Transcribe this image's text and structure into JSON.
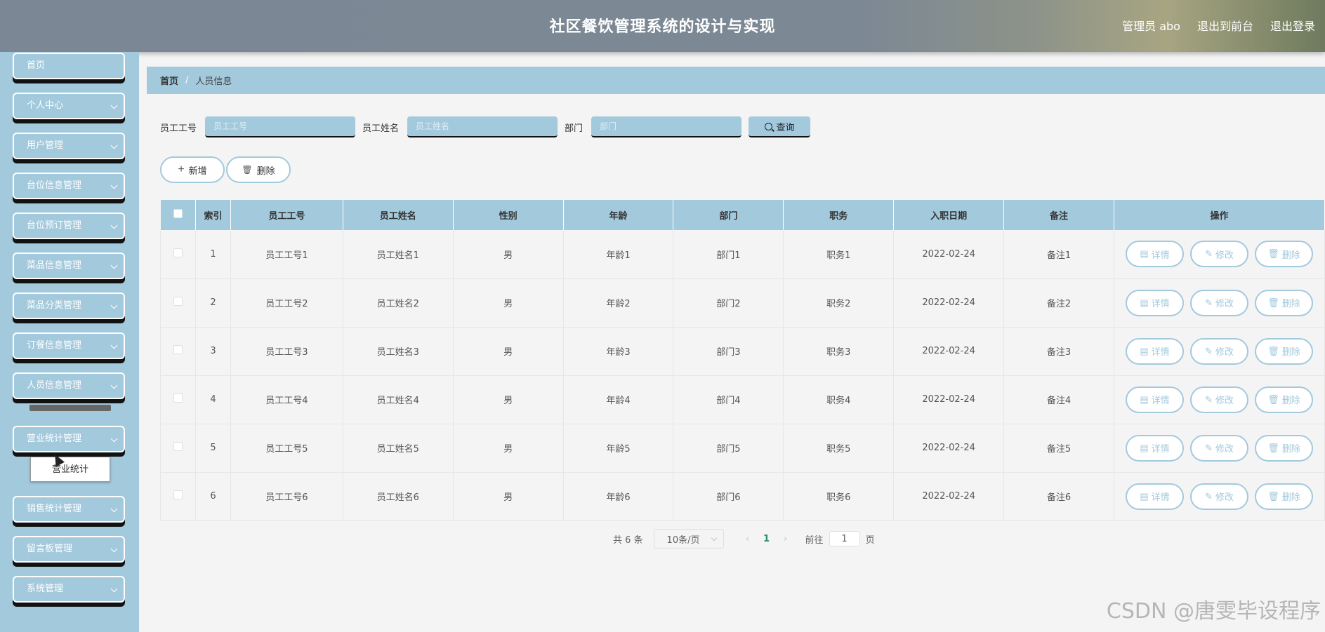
{
  "header": {
    "title": "社区餐饮管理系统的设计与实现",
    "user": "管理员 abo",
    "frontend_link": "退出到前台",
    "logout": "退出登录"
  },
  "sidebar": {
    "items": [
      {
        "label": "首页",
        "has_chevron": false
      },
      {
        "label": "个人中心",
        "has_chevron": true
      },
      {
        "label": "用户管理",
        "has_chevron": true
      },
      {
        "label": "台位信息管理",
        "has_chevron": true
      },
      {
        "label": "台位预订管理",
        "has_chevron": true
      },
      {
        "label": "菜品信息管理",
        "has_chevron": true
      },
      {
        "label": "菜品分类管理",
        "has_chevron": true
      },
      {
        "label": "订餐信息管理",
        "has_chevron": true
      },
      {
        "label": "人员信息管理",
        "has_chevron": true
      },
      {
        "label": "营业统计管理",
        "has_chevron": true
      },
      {
        "label": "销售统计管理",
        "has_chevron": true
      },
      {
        "label": "留言板管理",
        "has_chevron": true
      },
      {
        "label": "系统管理",
        "has_chevron": true
      }
    ],
    "popup_item": "营业统计"
  },
  "breadcrumb": {
    "home": "首页",
    "separator": "/",
    "current": "人员信息"
  },
  "search": {
    "emp_no_label": "员工工号",
    "emp_no_placeholder": "员工工号",
    "emp_name_label": "员工姓名",
    "emp_name_placeholder": "员工姓名",
    "dept_label": "部门",
    "dept_placeholder": "部门",
    "query_label": "查询"
  },
  "actions": {
    "add_label": "新增",
    "delete_label": "删除"
  },
  "table": {
    "headers": [
      "索引",
      "员工工号",
      "员工姓名",
      "性别",
      "年龄",
      "部门",
      "职务",
      "入职日期",
      "备注",
      "操作"
    ],
    "op_labels": {
      "detail": "详情",
      "edit": "修改",
      "delete": "删除"
    },
    "rows": [
      [
        "1",
        "员工工号1",
        "员工姓名1",
        "男",
        "年龄1",
        "部门1",
        "职务1",
        "2022-02-24",
        "备注1"
      ],
      [
        "2",
        "员工工号2",
        "员工姓名2",
        "男",
        "年龄2",
        "部门2",
        "职务2",
        "2022-02-24",
        "备注2"
      ],
      [
        "3",
        "员工工号3",
        "员工姓名3",
        "男",
        "年龄3",
        "部门3",
        "职务3",
        "2022-02-24",
        "备注3"
      ],
      [
        "4",
        "员工工号4",
        "员工姓名4",
        "男",
        "年龄4",
        "部门4",
        "职务4",
        "2022-02-24",
        "备注4"
      ],
      [
        "5",
        "员工工号5",
        "员工姓名5",
        "男",
        "年龄5",
        "部门5",
        "职务5",
        "2022-02-24",
        "备注5"
      ],
      [
        "6",
        "员工工号6",
        "员工姓名6",
        "男",
        "年龄6",
        "部门6",
        "职务6",
        "2022-02-24",
        "备注6"
      ]
    ]
  },
  "pagination": {
    "total": "共 6 条",
    "page_size": "10条/页",
    "current_page": "1",
    "goto_label": "前往",
    "goto_value": "1",
    "page_suffix": "页"
  },
  "watermark": "CSDN @唐雯毕设程序",
  "colors": {
    "accent": "#a3c9dc",
    "header": "#7b8794",
    "active_page": "#2d8a6e"
  }
}
